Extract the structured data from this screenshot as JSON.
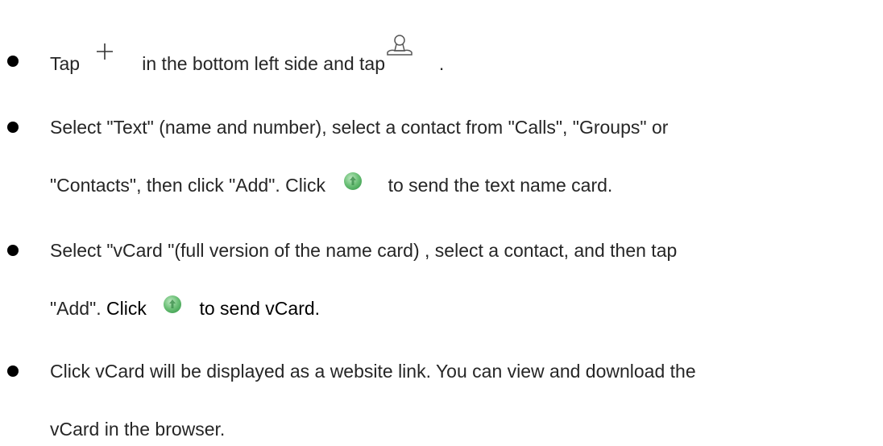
{
  "items": [
    {
      "lines": [
        {
          "t1": "Tap",
          "t2": "in the bottom left side and tap",
          "t3": "."
        }
      ]
    },
    {
      "lines": [
        {
          "t1": "Select \"Text\" (name and number), select a contact from \"Calls\", \"Groups\" or"
        },
        {
          "t1": "\"Contacts\", then click \"Add\". Click",
          "t2": "to send the text name card."
        }
      ]
    },
    {
      "lines": [
        {
          "t1": "Select \"vCard \"(full version of the name card) , select a contact, and then tap"
        },
        {
          "t1": "\"Add\".",
          "t2": "Click",
          "t3": "to send vCard."
        }
      ]
    },
    {
      "lines": [
        {
          "t1": "Click vCard will be displayed as a website link. You can view and download the"
        },
        {
          "t1": "vCard in the browser."
        }
      ]
    }
  ],
  "icons": {
    "plus": "plus-icon",
    "contact_card": "person-icon",
    "send": "send-icon"
  },
  "colors": {
    "send_icon": "#6fc27a",
    "icon_stroke": "#555555"
  }
}
